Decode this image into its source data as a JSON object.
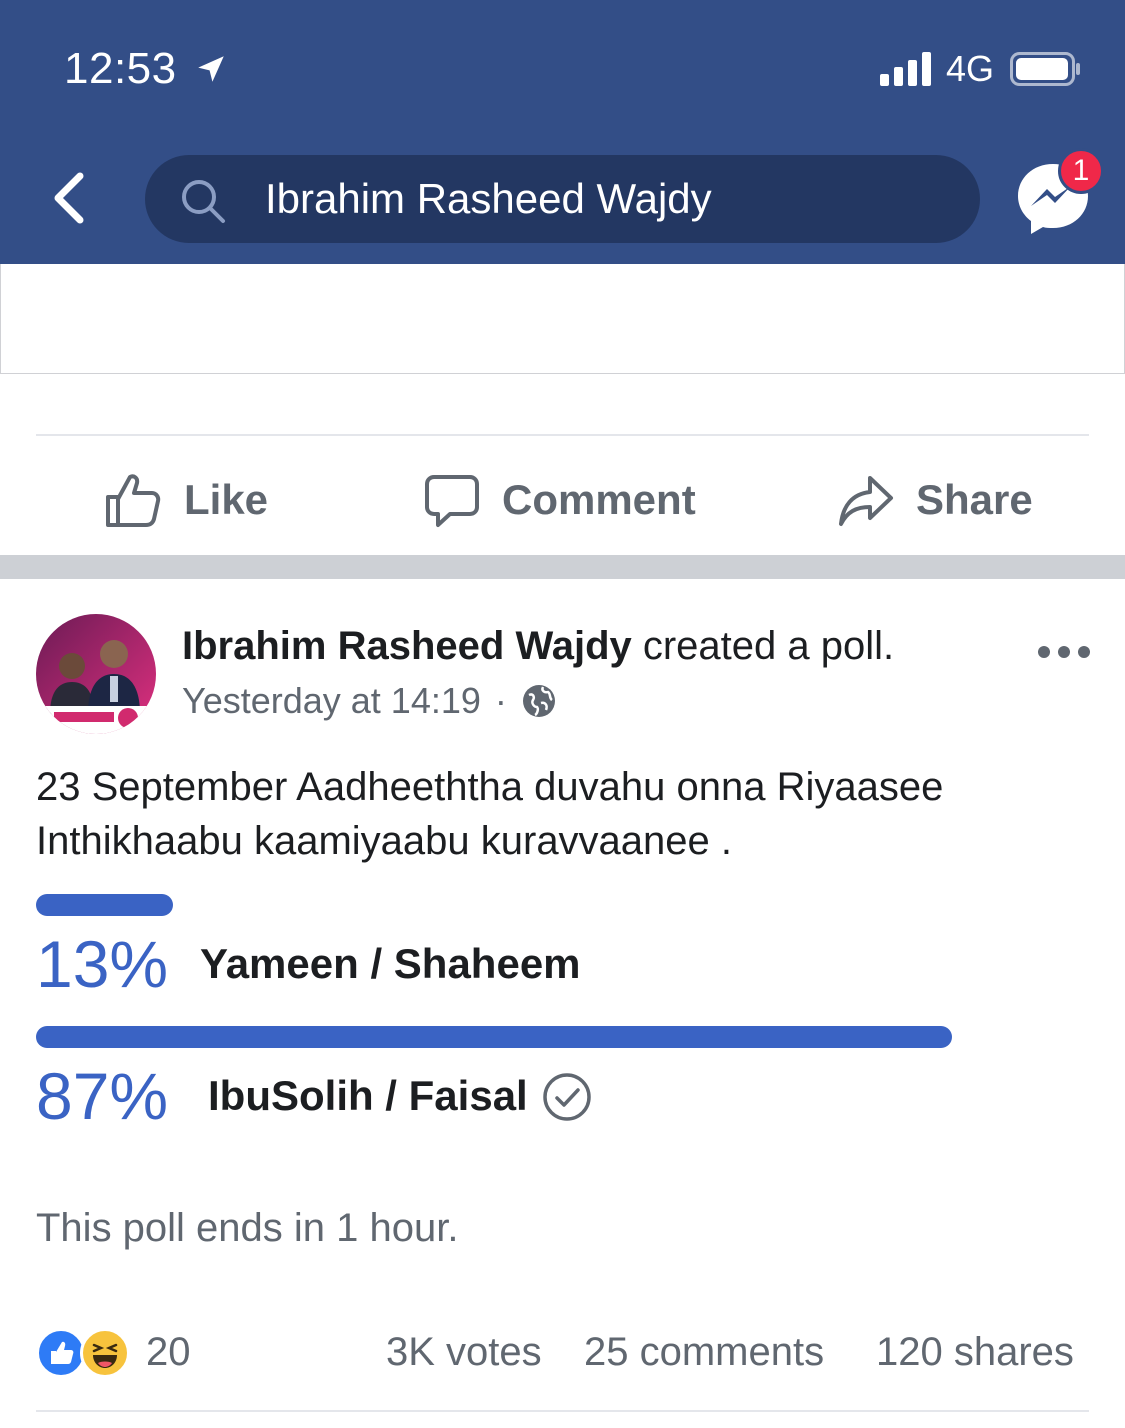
{
  "status_bar": {
    "time": "12:53",
    "network": "4G"
  },
  "top_bar": {
    "search_text": "Ibrahim Rasheed Wajdy",
    "messenger_badge": "1",
    "brand_color": "#334e87"
  },
  "prev_post_actions": {
    "like": "Like",
    "comment": "Comment",
    "share": "Share"
  },
  "post": {
    "author": "Ibrahim Rasheed Wajdy",
    "action_text": " created a poll.",
    "timestamp": "Yesterday at 14:19",
    "privacy_icon": "globe-icon",
    "text": "23 September Aadheeththa duvahu onna Riyaasee Inthikhaabu kaamiyaabu kuravvaanee .",
    "poll": {
      "options": [
        {
          "percent_label": "13%",
          "percent": 13,
          "label": "Yameen / Shaheem",
          "voted": false
        },
        {
          "percent_label": "87%",
          "percent": 87,
          "label": "IbuSolih / Faisal",
          "voted": true
        }
      ],
      "bar_color": "#3a63c4",
      "ends_text": "This poll ends in 1 hour."
    },
    "footer": {
      "reaction_icons": [
        "like-reaction-icon",
        "haha-reaction-icon"
      ],
      "reaction_count": "20",
      "votes": "3K votes",
      "comments": "25 comments",
      "shares": "120 shares"
    }
  }
}
